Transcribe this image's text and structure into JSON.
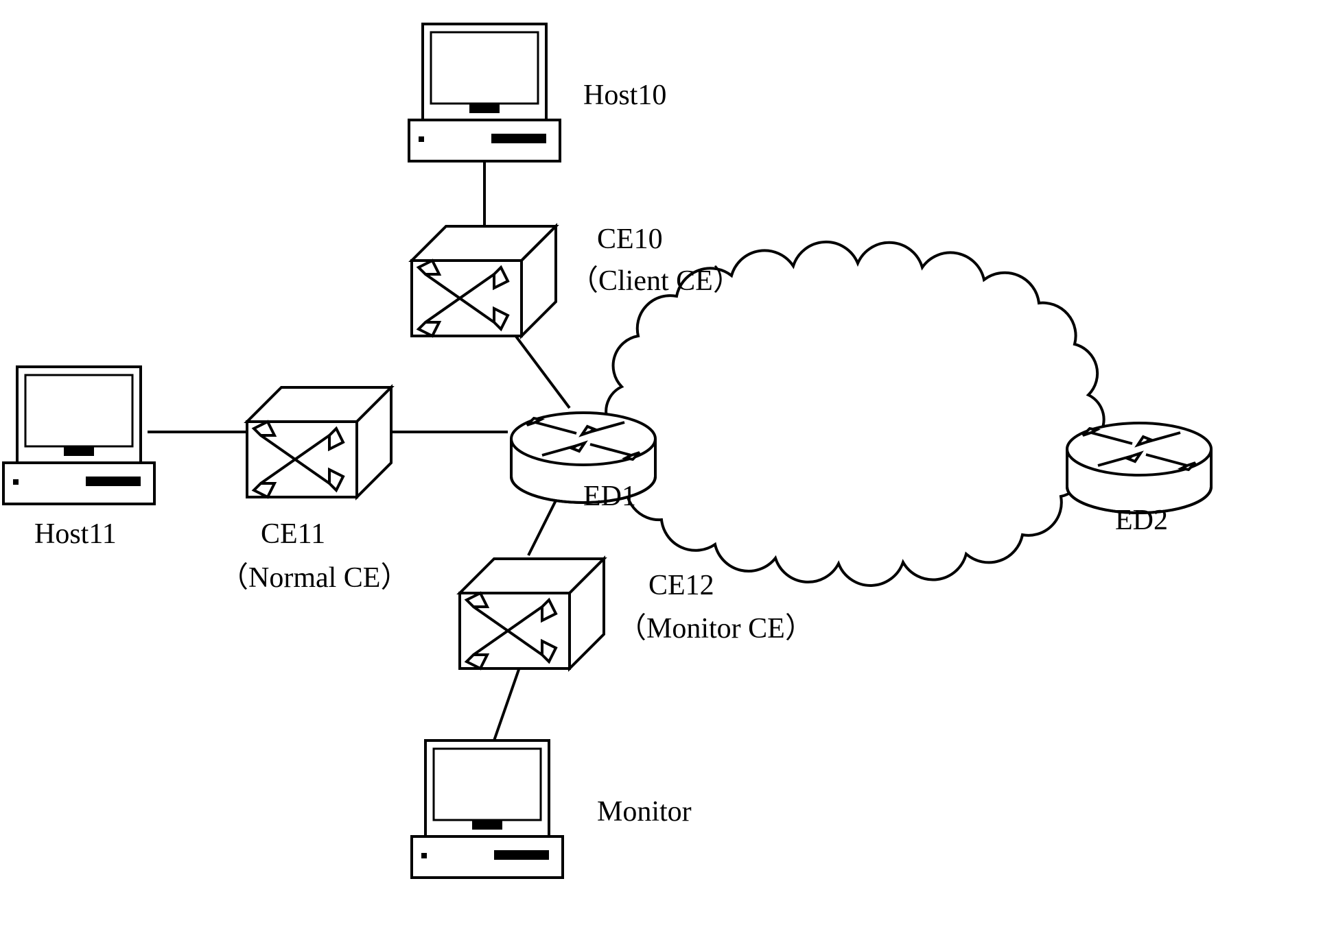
{
  "nodes": {
    "host10": {
      "label": "Host10",
      "type": "host"
    },
    "host11": {
      "label": "Host11",
      "type": "host"
    },
    "monitor": {
      "label": "Monitor",
      "type": "host"
    },
    "ce10": {
      "label": "CE10",
      "sublabel": "（Client CE）",
      "type": "switch"
    },
    "ce11": {
      "label": "CE11",
      "sublabel": "（Normal CE）",
      "type": "switch"
    },
    "ce12": {
      "label": "CE12",
      "sublabel": "（Monitor CE）",
      "type": "switch"
    },
    "ed1": {
      "label": "ED1",
      "type": "router"
    },
    "ed2": {
      "label": "ED2",
      "type": "router"
    }
  },
  "links": [
    {
      "from": "host10",
      "to": "ce10"
    },
    {
      "from": "ce10",
      "to": "ed1"
    },
    {
      "from": "host11",
      "to": "ce11"
    },
    {
      "from": "ce11",
      "to": "ed1"
    },
    {
      "from": "ed1",
      "to": "ce12"
    },
    {
      "from": "ce12",
      "to": "monitor"
    },
    {
      "from": "ed1",
      "to": "ed2",
      "via": "cloud"
    }
  ],
  "cloud": {
    "label": "",
    "type": "network-cloud"
  }
}
